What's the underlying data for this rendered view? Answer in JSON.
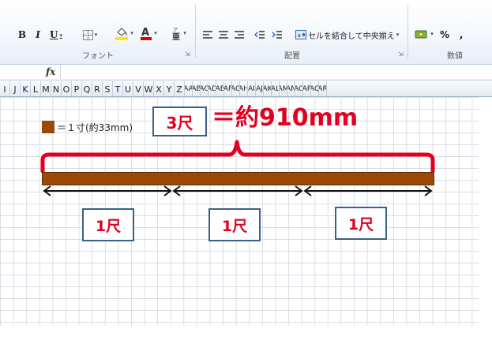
{
  "ribbon": {
    "bold": "B",
    "italic": "I",
    "underline": "U",
    "percent": "%",
    "comma": ",",
    "merge_center": "セルを結合して中央揃え",
    "groups": {
      "font": "フォント",
      "alignment": "配置",
      "number": "数値"
    }
  },
  "formula_bar": {
    "fx": "fx"
  },
  "columns": [
    "I",
    "J",
    "K",
    "L",
    "M",
    "N",
    "O",
    "P",
    "Q",
    "R",
    "S",
    "T",
    "U",
    "V",
    "W",
    "X",
    "Y",
    "Z",
    "AA",
    "AB",
    "AC",
    "AD",
    "AE",
    "AF",
    "AG",
    "AH",
    "AI",
    "AJ",
    "AK",
    "AL",
    "AM",
    "AN",
    "AO",
    "AP",
    "AQ",
    "AR"
  ],
  "diagram": {
    "legend": "＝１寸(約33mm)",
    "total_label": "3尺",
    "total_value": "＝約910mm",
    "unit_labels": [
      "1尺",
      "1尺",
      "1尺"
    ]
  },
  "colors": {
    "bar": "#9a4a06",
    "accent_red": "#e20020",
    "box_border": "#3a6187"
  }
}
